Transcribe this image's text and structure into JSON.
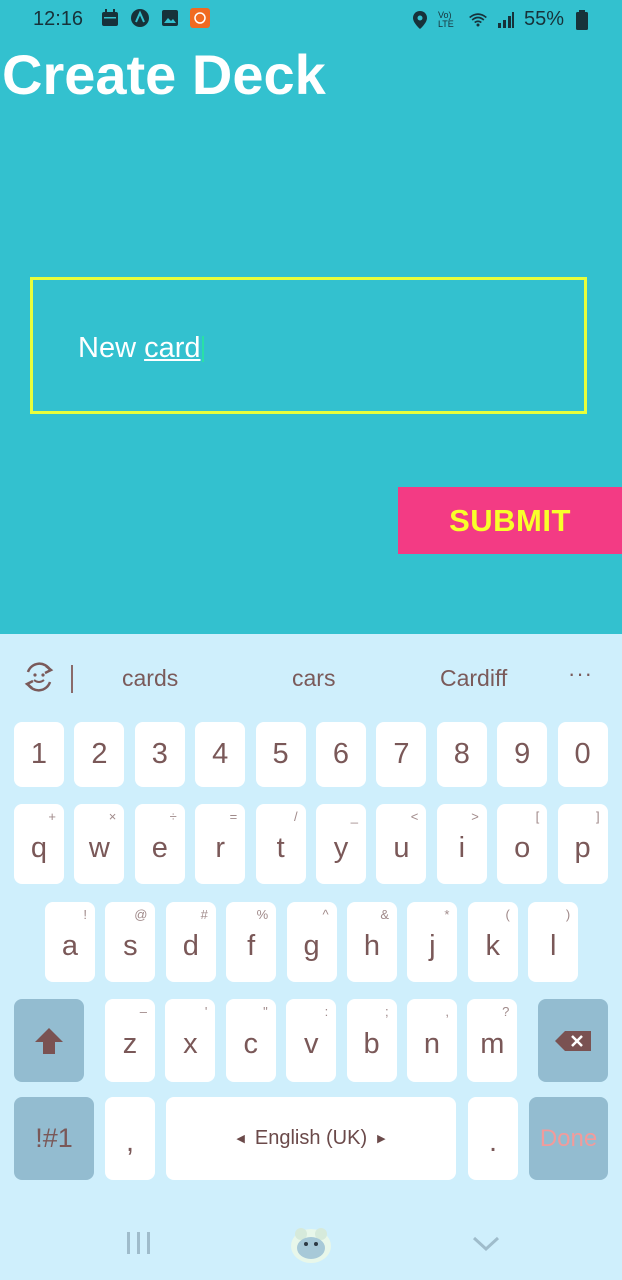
{
  "status": {
    "time": "12:16",
    "battery": "55%",
    "net": "Vo) LTE"
  },
  "app": {
    "title": "Create Deck"
  },
  "form": {
    "input_value_1": "New ",
    "input_value_2": "card",
    "submit_label": "SUBMIT"
  },
  "keyboard": {
    "suggestions": [
      "cards",
      "cars",
      "Cardiff"
    ],
    "more": "···",
    "row_numbers": [
      "1",
      "2",
      "3",
      "4",
      "5",
      "6",
      "7",
      "8",
      "9",
      "0"
    ],
    "row1": [
      {
        "k": "q",
        "h": "+"
      },
      {
        "k": "w",
        "h": "×"
      },
      {
        "k": "e",
        "h": "÷"
      },
      {
        "k": "r",
        "h": "="
      },
      {
        "k": "t",
        "h": "/"
      },
      {
        "k": "y",
        "h": "_"
      },
      {
        "k": "u",
        "h": "<"
      },
      {
        "k": "i",
        "h": ">"
      },
      {
        "k": "o",
        "h": "["
      },
      {
        "k": "p",
        "h": "]"
      }
    ],
    "row2": [
      {
        "k": "a",
        "h": "!"
      },
      {
        "k": "s",
        "h": "@"
      },
      {
        "k": "d",
        "h": "#"
      },
      {
        "k": "f",
        "h": "%"
      },
      {
        "k": "g",
        "h": "^"
      },
      {
        "k": "h",
        "h": "&"
      },
      {
        "k": "j",
        "h": "*"
      },
      {
        "k": "k",
        "h": "("
      },
      {
        "k": "l",
        "h": ")"
      }
    ],
    "row3": [
      {
        "k": "z",
        "h": "–"
      },
      {
        "k": "x",
        "h": "'"
      },
      {
        "k": "c",
        "h": "\""
      },
      {
        "k": "v",
        "h": ":"
      },
      {
        "k": "b",
        "h": ";"
      },
      {
        "k": "n",
        "h": ","
      },
      {
        "k": "m",
        "h": "?"
      }
    ],
    "symbols_label": "!#1",
    "comma": ",",
    "language": "English (UK)",
    "period": ".",
    "done_label": "Done"
  }
}
